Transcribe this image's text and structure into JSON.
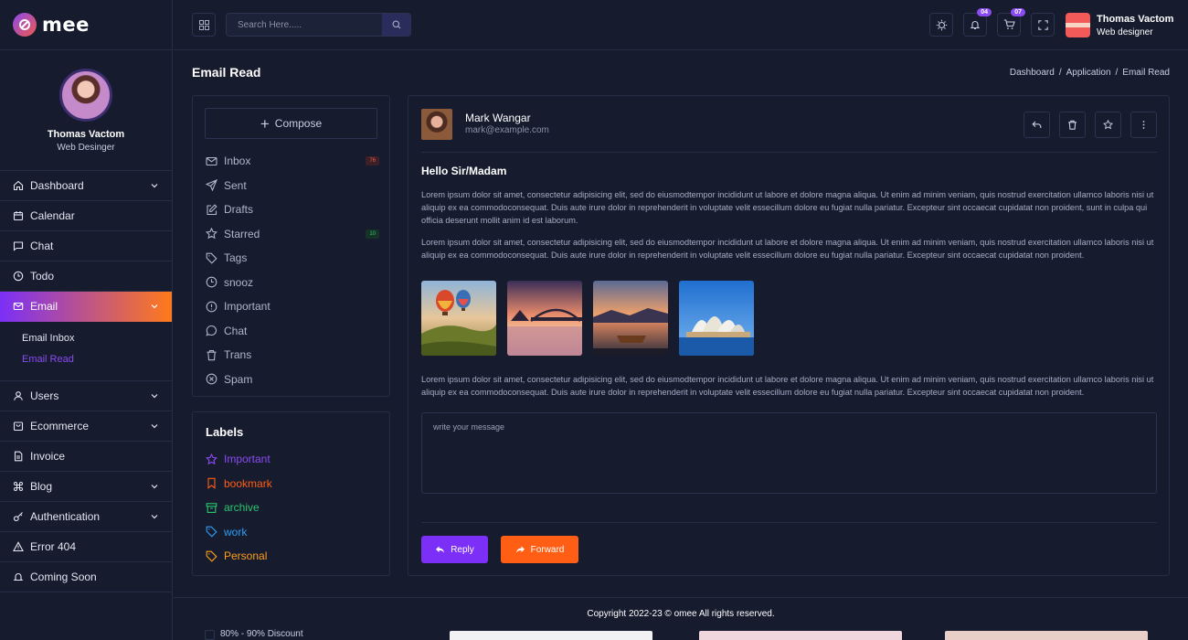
{
  "brand": {
    "name": "mee"
  },
  "profile": {
    "name": "Thomas Vactom",
    "role": "Web Desinger"
  },
  "nav": [
    {
      "label": "Dashboard",
      "icon": "home-icon",
      "has_children": true
    },
    {
      "label": "Calendar",
      "icon": "calendar-icon",
      "has_children": false
    },
    {
      "label": "Chat",
      "icon": "chat-icon",
      "has_children": false
    },
    {
      "label": "Todo",
      "icon": "clock-icon",
      "has_children": false
    },
    {
      "label": "Email",
      "icon": "mail-icon",
      "has_children": true,
      "active": true
    },
    {
      "label": "Users",
      "icon": "user-icon",
      "has_children": true
    },
    {
      "label": "Ecommerce",
      "icon": "bag-icon",
      "has_children": true
    },
    {
      "label": "Invoice",
      "icon": "file-icon",
      "has_children": false
    },
    {
      "label": "Blog",
      "icon": "command-icon",
      "has_children": true
    },
    {
      "label": "Authentication",
      "icon": "key-icon",
      "has_children": true
    },
    {
      "label": "Error 404",
      "icon": "warning-icon",
      "has_children": false
    },
    {
      "label": "Coming Soon",
      "icon": "bell-icon",
      "has_children": false
    }
  ],
  "email_subnav": [
    {
      "label": "Email Inbox",
      "current": false
    },
    {
      "label": "Email Read",
      "current": true
    }
  ],
  "topbar": {
    "search_placeholder": "Search Here.....",
    "notifications_count": "04",
    "cart_count": "07",
    "user_name": "Thomas Vactom",
    "user_role": "Web designer"
  },
  "page": {
    "title": "Email Read",
    "breadcrumb": [
      "Dashboard",
      "Application",
      "Email Read"
    ]
  },
  "compose_label": "Compose",
  "folders": [
    {
      "label": "Inbox",
      "icon": "mail-icon",
      "count": "76",
      "count_color": "red"
    },
    {
      "label": "Sent",
      "icon": "send-icon"
    },
    {
      "label": "Drafts",
      "icon": "edit-icon"
    },
    {
      "label": "Starred",
      "icon": "star-icon",
      "count": "10",
      "count_color": "green"
    },
    {
      "label": "Tags",
      "icon": "tag-icon"
    },
    {
      "label": "snooz",
      "icon": "clock-icon"
    },
    {
      "label": "Important",
      "icon": "alert-circle-icon"
    },
    {
      "label": "Chat",
      "icon": "chat-bubble-icon"
    },
    {
      "label": "Trans",
      "icon": "trash-icon"
    },
    {
      "label": "Spam",
      "icon": "x-circle-icon"
    }
  ],
  "labels": {
    "title": "Labels",
    "items": [
      {
        "label": "Important",
        "icon": "star-icon",
        "color": "#8a4bf0"
      },
      {
        "label": "bookmark",
        "icon": "bookmark-icon",
        "color": "#ff5e14"
      },
      {
        "label": "archive",
        "icon": "archive-icon",
        "color": "#29c76f"
      },
      {
        "label": "work",
        "icon": "tag-icon",
        "color": "#2e9ef5"
      },
      {
        "label": "Personal",
        "icon": "tag-icon",
        "color": "#ff9f1a"
      }
    ]
  },
  "email": {
    "sender_name": "Mark Wangar",
    "sender_email": "mark@example.com",
    "subject": "Hello Sir/Madam",
    "paragraphs": [
      "Lorem ipsum dolor sit amet, consectetur adipisicing elit, sed do eiusmodtempor incididunt ut labore et dolore magna aliqua. Ut enim ad minim veniam, quis nostrud exercitation ullamco laboris nisi ut aliquip ex ea commodoconsequat. Duis aute irure dolor in reprehenderit in voluptate velit essecillum dolore eu fugiat nulla pariatur. Excepteur sint occaecat cupidatat non proident, sunt in culpa qui officia deserunt mollit anim id est laborum.",
      "Lorem ipsum dolor sit amet, consectetur adipisicing elit, sed do eiusmodtempor incididunt ut labore et dolore magna aliqua. Ut enim ad minim veniam, quis nostrud exercitation ullamco laboris nisi ut aliquip ex ea commodoconsequat. Duis aute irure dolor in reprehenderit in voluptate velit essecillum dolore eu fugiat nulla pariatur. Excepteur sint occaecat cupidatat non proident.",
      "Lorem ipsum dolor sit amet, consectetur adipisicing elit, sed do eiusmodtempor incididunt ut labore et dolore magna aliqua. Ut enim ad minim veniam, quis nostrud exercitation ullamco laboris nisi ut aliquip ex ea commodoconsequat. Duis aute irure dolor in reprehenderit in voluptate velit essecillum dolore eu fugiat nulla pariatur. Excepteur sint occaecat cupidatat non proident."
    ],
    "attachments": [
      "hot-air-balloons",
      "sydney-harbour-bridge-sunset",
      "boat-lake-sunset",
      "sydney-opera-house"
    ],
    "reply_placeholder": "write your message",
    "reply_label": "Reply",
    "forward_label": "Forward"
  },
  "footer": {
    "copyright": "Copyright 2022-23 © omee All rights reserved.",
    "behind_text": "80% - 90% Discount"
  },
  "colors": {
    "background": "#161b2e",
    "border": "#262c44",
    "accent_purple": "#7b2ff7",
    "accent_orange": "#ff5e14"
  }
}
